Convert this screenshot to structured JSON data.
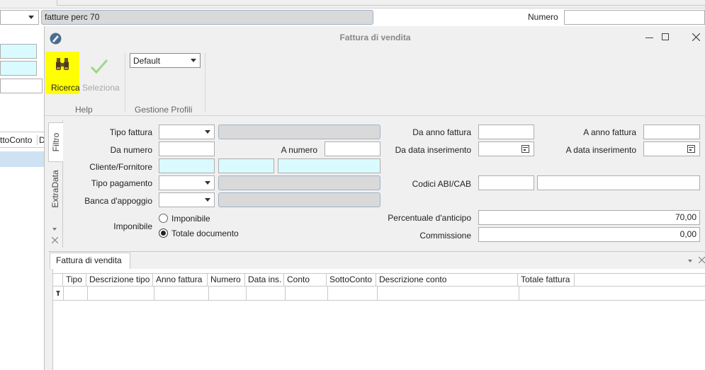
{
  "background": {
    "search_input": "fatture perc 70",
    "numero_label": "Numero",
    "column_partial_1": "ttoConto",
    "column_partial_2": "D"
  },
  "window": {
    "title": "Fattura di vendita",
    "minimize_icon": "minimize-icon",
    "maximize_icon": "maximize-icon",
    "close_icon": "close-icon"
  },
  "toolbar": {
    "ricerca_label": "Ricerca",
    "seleziona_label": "Seleziona",
    "profile_selected": "Default",
    "group_help": "Help",
    "group_profili": "Gestione Profili",
    "highlight_color": "#ffff00"
  },
  "side_tabs": {
    "filtro": "Filtro",
    "extradata": "ExtraData"
  },
  "form": {
    "tipo_fattura_label": "Tipo fattura",
    "da_numero_label": "Da numero",
    "a_numero_label": "A numero",
    "cliente_fornitore_label": "Cliente/Fornitore",
    "tipo_pagamento_label": "Tipo pagamento",
    "banca_appoggio_label": "Banca d'appoggio",
    "imponibile_label": "Imponibile",
    "radio_imponibile": "Imponibile",
    "radio_totale": "Totale documento",
    "da_anno_fattura_label": "Da anno fattura",
    "a_anno_fattura_label": "A anno fattura",
    "da_data_ins_label": "Da data inserimento",
    "a_data_ins_label": "A data inserimento",
    "codici_abi_cab_label": "Codici ABI/CAB",
    "percentuale_anticipo_label": "Percentuale d'anticipo",
    "percentuale_anticipo_value": "70,00",
    "commissione_label": "Commissione",
    "commissione_value": "0,00"
  },
  "grid": {
    "tab_label": "Fattura di vendita",
    "columns": [
      "Tipo",
      "Descrizione tipo",
      "Anno fattura",
      "Numero",
      "Data ins.",
      "Conto",
      "SottoConto",
      "Descrizione conto",
      "Totale fattura"
    ]
  }
}
